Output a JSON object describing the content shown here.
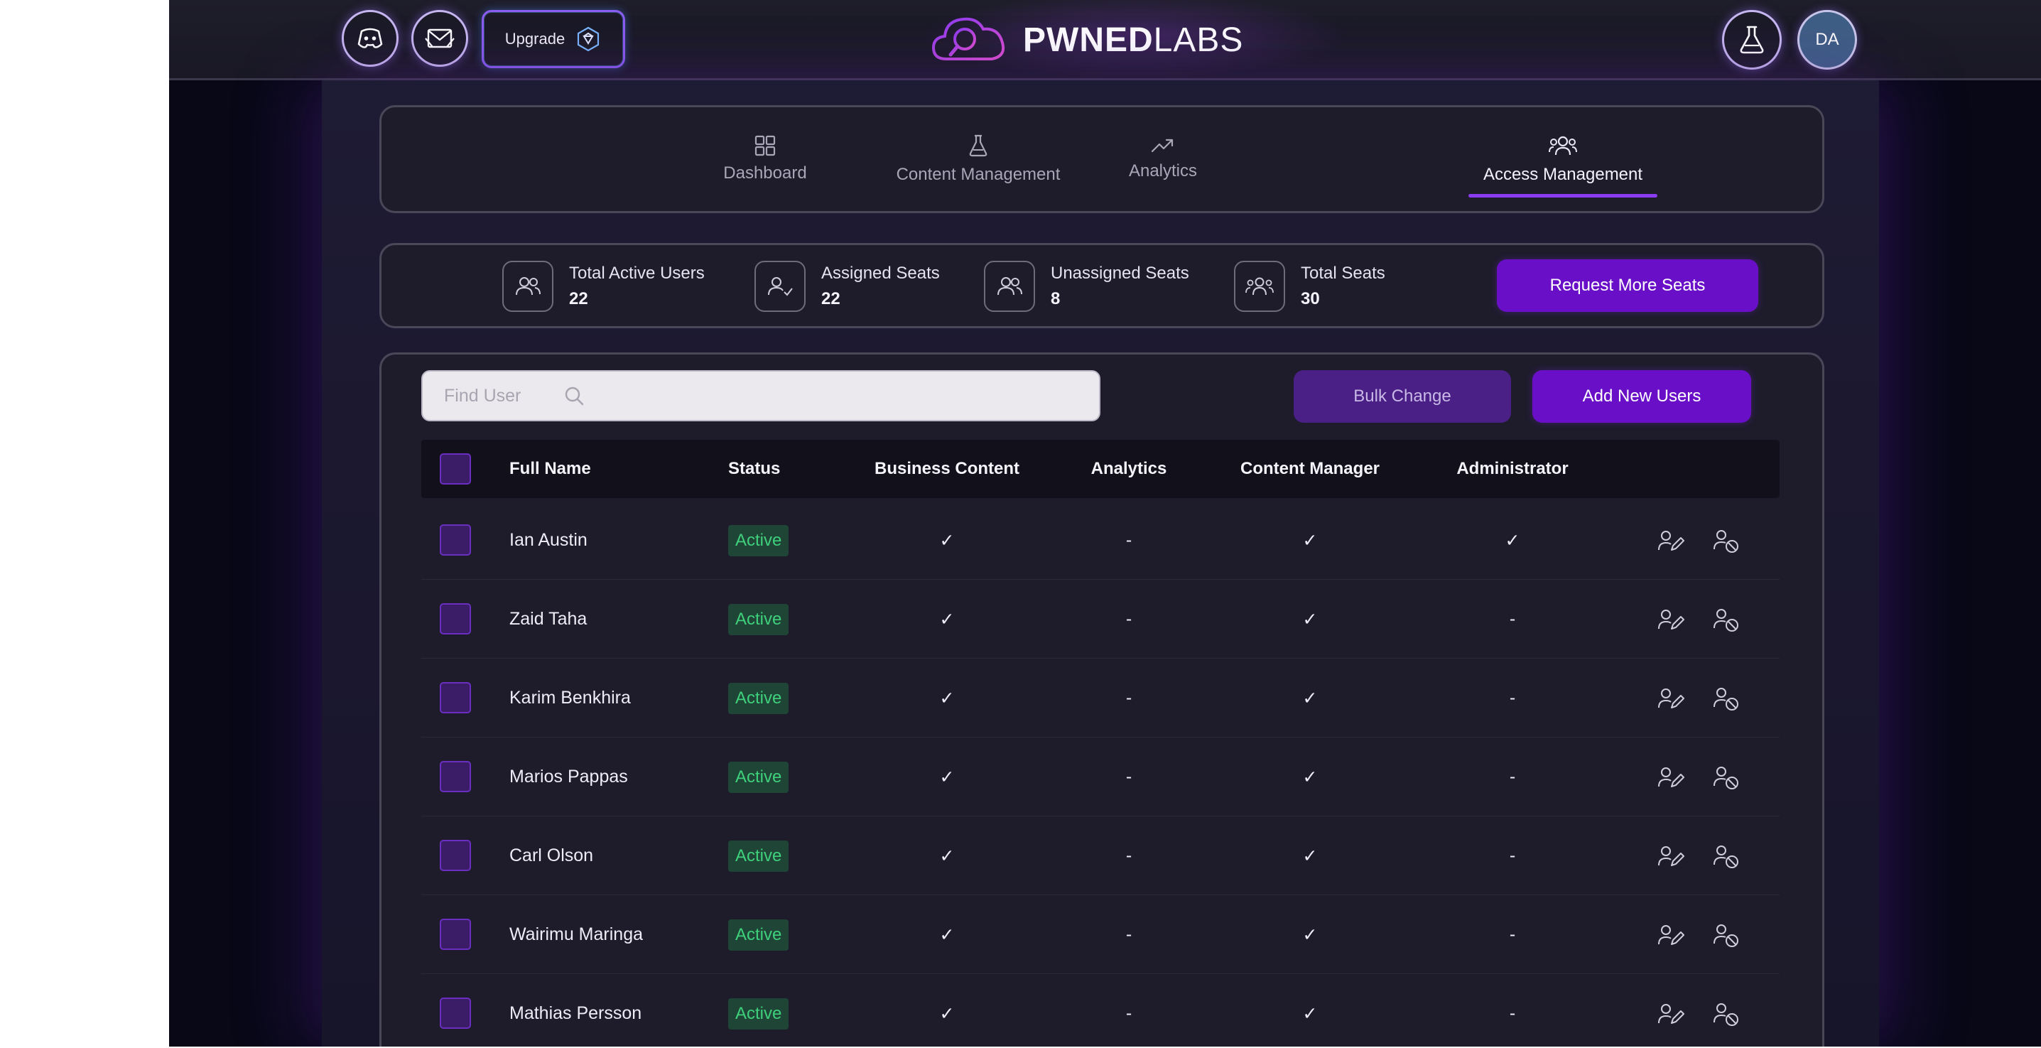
{
  "header": {
    "upgrade_label": "Upgrade",
    "logo_bold": "PWNED",
    "logo_light": "LABS",
    "avatar_initials": "DA",
    "icons": [
      "discord-icon",
      "newsletter-icon",
      "diamond-icon",
      "flask-icon"
    ]
  },
  "nav": {
    "tabs": [
      {
        "label": "Dashboard",
        "icon": "grid-icon"
      },
      {
        "label": "Content Management",
        "icon": "flask-icon"
      },
      {
        "label": "Analytics",
        "icon": "trend-icon"
      },
      {
        "label": "Access Management",
        "icon": "users-icon",
        "active": true
      }
    ]
  },
  "stats": [
    {
      "label": "Total Active Users",
      "value": "22"
    },
    {
      "label": "Assigned Seats",
      "value": "22"
    },
    {
      "label": "Unassigned Seats",
      "value": "8"
    },
    {
      "label": "Total Seats",
      "value": "30"
    }
  ],
  "request_seats_label": "Request More Seats",
  "toolbar": {
    "search_placeholder": "Find User",
    "bulk_change_label": "Bulk Change",
    "add_users_label": "Add New Users"
  },
  "table": {
    "headers": {
      "full_name": "Full Name",
      "status": "Status",
      "business_content": "Business Content",
      "analytics": "Analytics",
      "content_manager": "Content Manager",
      "administrator": "Administrator"
    },
    "rows": [
      {
        "name": "Ian Austin",
        "status": "Active",
        "business": "✓",
        "analytics": "-",
        "content_manager": "✓",
        "administrator": "✓"
      },
      {
        "name": "Zaid Taha",
        "status": "Active",
        "business": "✓",
        "analytics": "-",
        "content_manager": "✓",
        "administrator": "-"
      },
      {
        "name": "Karim Benkhira",
        "status": "Active",
        "business": "✓",
        "analytics": "-",
        "content_manager": "✓",
        "administrator": "-"
      },
      {
        "name": "Marios Pappas",
        "status": "Active",
        "business": "✓",
        "analytics": "-",
        "content_manager": "✓",
        "administrator": "-"
      },
      {
        "name": "Carl Olson",
        "status": "Active",
        "business": "✓",
        "analytics": "-",
        "content_manager": "✓",
        "administrator": "-"
      },
      {
        "name": "Wairimu Maringa",
        "status": "Active",
        "business": "✓",
        "analytics": "-",
        "content_manager": "✓",
        "administrator": "-"
      },
      {
        "name": "Mathias Persson",
        "status": "Active",
        "business": "✓",
        "analytics": "-",
        "content_manager": "✓",
        "administrator": "-"
      }
    ]
  },
  "colors": {
    "accent": "#6a0fc8",
    "active_text": "#3fd07c",
    "active_bg": "#1e4536",
    "background": "#080817",
    "panel": "#1e1c2b"
  }
}
